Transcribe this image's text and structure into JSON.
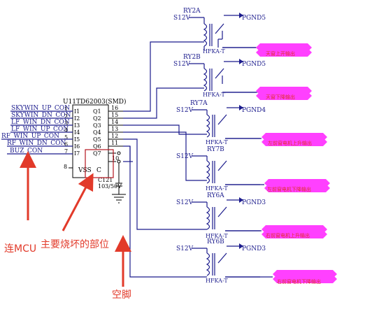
{
  "ic": {
    "ref": "U11TD62003(SMD)",
    "inputs": [
      {
        "net": "SKYWIN_UP_CON",
        "name": "I1",
        "pin": "1"
      },
      {
        "net": "SKYWIN_DN_CON",
        "name": "I2",
        "pin": "2"
      },
      {
        "net": "LF_WIN_DN_CON",
        "name": "I3",
        "pin": "3"
      },
      {
        "net": "LF_WIN_UP_CON",
        "name": "I4",
        "pin": "4"
      },
      {
        "net": "RF_WIN_UP_CON",
        "name": "I5",
        "pin": "5"
      },
      {
        "net": "RF_WIN_DN_CON",
        "name": "I6",
        "pin": "6"
      },
      {
        "net": "BUZ_CON",
        "name": "I7",
        "pin": "7"
      }
    ],
    "outputs": [
      {
        "name": "Q1",
        "pin": "16"
      },
      {
        "name": "Q2",
        "pin": "15"
      },
      {
        "name": "Q3",
        "pin": "14"
      },
      {
        "name": "Q4",
        "pin": "13"
      },
      {
        "name": "Q5",
        "pin": "12"
      },
      {
        "name": "Q6",
        "pin": "11"
      },
      {
        "name": "Q7",
        "pin": ""
      }
    ],
    "vss_label": "VSS",
    "vss_pin": "8",
    "c_label": "C",
    "c_pin": "10"
  },
  "capacitor": {
    "ref": "C121",
    "value": "103/50V"
  },
  "relays": [
    {
      "ref": "RY2A",
      "supply": "S12V",
      "gnd": "PGND5",
      "model": "HFKA-T",
      "output_tag": "天窗上开输出"
    },
    {
      "ref": "RY2B",
      "supply": "S12V",
      "gnd": "PGND5",
      "model": "HFKA-T",
      "output_tag": "天窗下降输出"
    },
    {
      "ref": "RY7A",
      "supply": "S12V",
      "gnd": "PGND4",
      "model": "HFKA-T",
      "output_tag": "左前窗电机上升输出"
    },
    {
      "ref": "RY7B",
      "supply": "S12V",
      "gnd": "PGND4",
      "model": "HFKA-T",
      "output_tag": "左前窗电机下降输出"
    },
    {
      "ref": "RY6A",
      "supply": "S12V",
      "gnd": "PGND3",
      "model": "HFKA-T",
      "output_tag": "右前窗电机上升输出"
    },
    {
      "ref": "RY6B",
      "supply": "S12V",
      "gnd": "PGND3",
      "model": "HFKA-T",
      "output_tag": "右前窗电机下降输出"
    }
  ],
  "annotations": {
    "mcu": "连MCU",
    "damage": "主要烧坏的部位",
    "nc": "空脚"
  },
  "colors": {
    "wire": "#1b1b8c",
    "tag_fill": "#ff40ff",
    "tag_text": "#e0302a",
    "annotation": "#e23a2a",
    "highlight_box": "#b4141e"
  }
}
